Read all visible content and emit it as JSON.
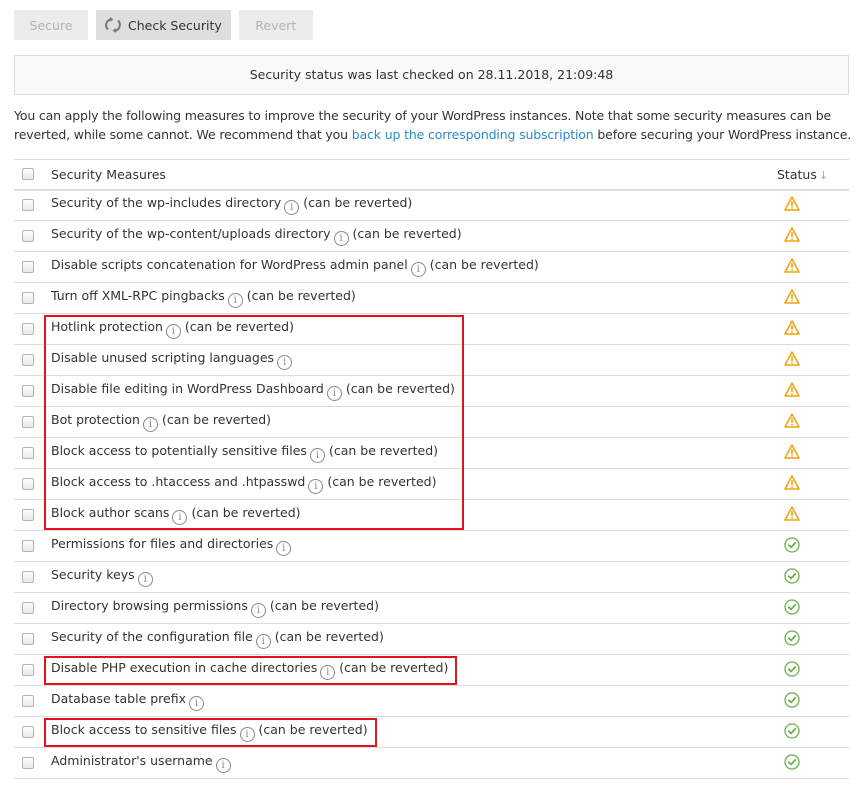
{
  "toolbar": {
    "secure_label": "Secure",
    "check_label": "Check Security",
    "revert_label": "Revert"
  },
  "status_message": "Security status was last checked on 28.11.2018, 21:09:48",
  "intro": {
    "text_before": "You can apply the following measures to improve the security of your WordPress instances. Note that some security measures can be reverted, while some cannot. We recommend that you ",
    "link_text": "back up the corresponding subscription",
    "text_after": " before securing your WordPress instance."
  },
  "table": {
    "header_measures": "Security Measures",
    "header_status": "Status",
    "sort_indicator": "↓",
    "revert_note": "(can be reverted)",
    "colors": {
      "warning": "#f0a30a",
      "ok": "#6ab04c",
      "highlight": "#e0141e",
      "link": "#2d8ac7"
    },
    "rows": [
      {
        "name": "Security of the wp-includes directory",
        "revertible": true,
        "status": "warning"
      },
      {
        "name": "Security of the wp-content/uploads directory",
        "revertible": true,
        "status": "warning"
      },
      {
        "name": "Disable scripts concatenation for WordPress admin panel",
        "revertible": true,
        "status": "warning"
      },
      {
        "name": "Turn off XML-RPC pingbacks",
        "revertible": true,
        "status": "warning"
      },
      {
        "name": "Hotlink protection",
        "revertible": true,
        "status": "warning"
      },
      {
        "name": "Disable unused scripting languages",
        "revertible": false,
        "status": "warning"
      },
      {
        "name": "Disable file editing in WordPress Dashboard",
        "revertible": true,
        "status": "warning"
      },
      {
        "name": "Bot protection",
        "revertible": true,
        "status": "warning"
      },
      {
        "name": "Block access to potentially sensitive files",
        "revertible": true,
        "status": "warning"
      },
      {
        "name": "Block access to .htaccess and .htpasswd",
        "revertible": true,
        "status": "warning"
      },
      {
        "name": "Block author scans",
        "revertible": true,
        "status": "warning"
      },
      {
        "name": "Permissions for files and directories",
        "revertible": false,
        "status": "ok"
      },
      {
        "name": "Security keys",
        "revertible": false,
        "status": "ok"
      },
      {
        "name": "Directory browsing permissions",
        "revertible": true,
        "status": "ok"
      },
      {
        "name": "Security of the configuration file",
        "revertible": true,
        "status": "ok"
      },
      {
        "name": "Disable PHP execution in cache directories",
        "revertible": true,
        "status": "ok"
      },
      {
        "name": "Database table prefix",
        "revertible": false,
        "status": "ok"
      },
      {
        "name": "Block access to sensitive files",
        "revertible": true,
        "status": "ok"
      },
      {
        "name": "Administrator's username",
        "revertible": false,
        "status": "ok"
      }
    ]
  },
  "annotations": [
    {
      "label": "highlight-group-1",
      "rows": [
        4,
        10
      ]
    },
    {
      "label": "highlight-group-2",
      "rows": [
        15,
        15
      ]
    },
    {
      "label": "highlight-group-3",
      "rows": [
        17,
        17
      ]
    }
  ]
}
